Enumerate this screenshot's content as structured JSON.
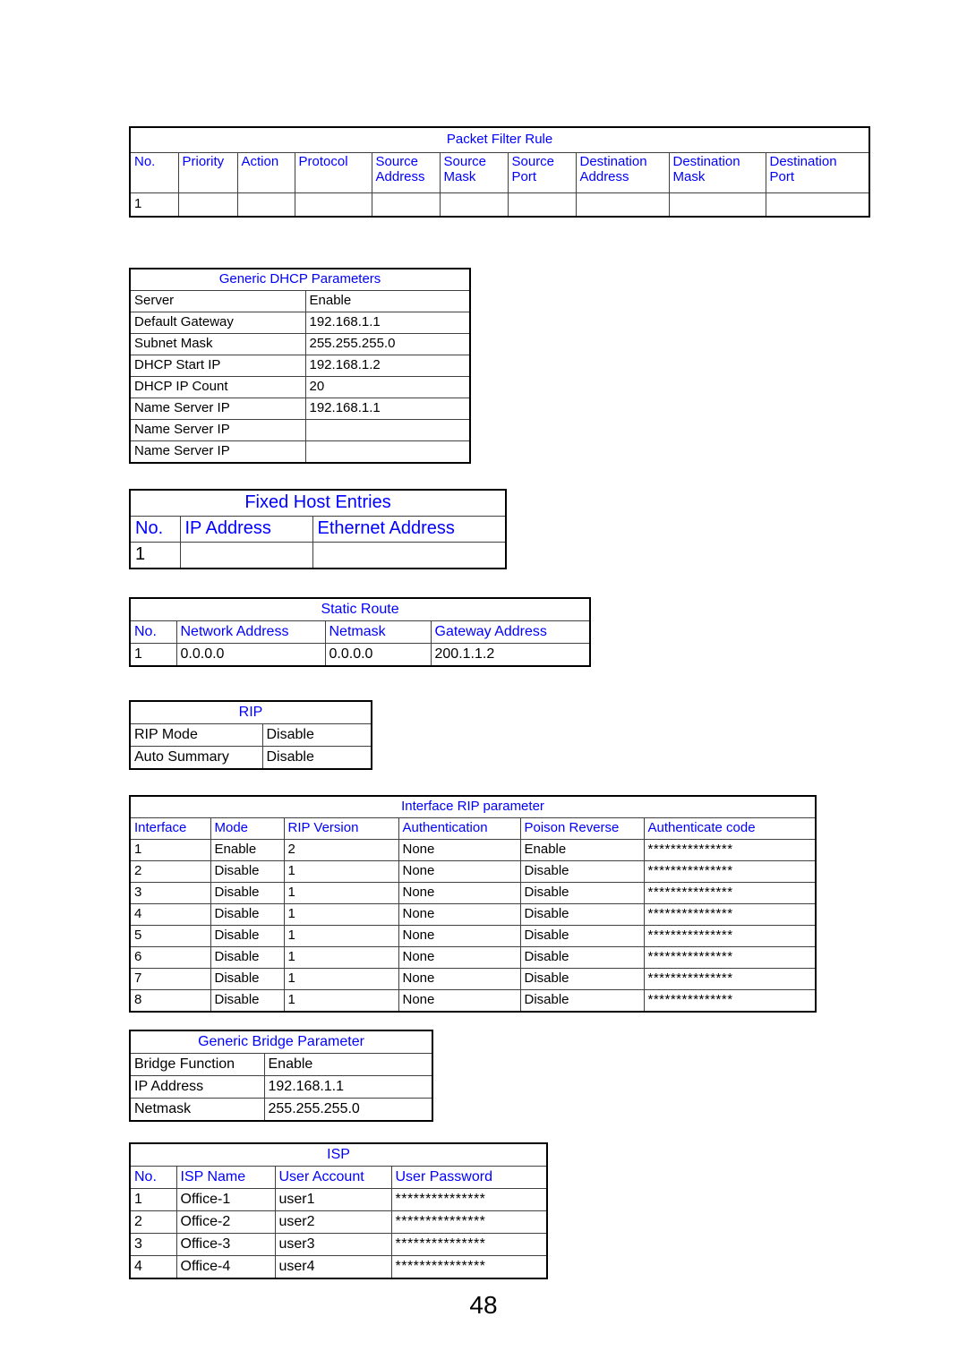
{
  "page": {
    "number": "48",
    "accent_color": "#0000FF",
    "text_color": "#000000",
    "background": "#FFFFFF"
  },
  "packet_filter_rule": {
    "title": "Packet Filter Rule",
    "headers": [
      "No.",
      "Priority",
      "Action",
      "Protocol",
      "Source Address",
      "Source Mask",
      "Source Port",
      "Destination Address",
      "Destination Mask",
      "Destination Port"
    ],
    "rows": [
      [
        "1",
        "",
        "",
        "",
        "",
        "",
        "",
        "",
        "",
        ""
      ]
    ]
  },
  "generic_dhcp_parameters": {
    "title": "Generic DHCP Parameters",
    "rows": [
      {
        "label": "Server",
        "value": "Enable"
      },
      {
        "label": "Default Gateway",
        "value": "192.168.1.1"
      },
      {
        "label": "Subnet Mask",
        "value": "255.255.255.0"
      },
      {
        "label": "DHCP Start IP",
        "value": "192.168.1.2"
      },
      {
        "label": "DHCP IP Count",
        "value": "20"
      },
      {
        "label": "Name Server IP",
        "value": "192.168.1.1"
      },
      {
        "label": "Name Server IP",
        "value": ""
      },
      {
        "label": "Name Server IP",
        "value": ""
      }
    ]
  },
  "fixed_host_entries": {
    "title": "Fixed Host Entries",
    "headers": [
      "No.",
      "IP Address",
      "Ethernet Address"
    ],
    "rows": [
      [
        "1",
        "",
        ""
      ]
    ]
  },
  "static_route": {
    "title": "Static Route",
    "headers": [
      "No.",
      "Network Address",
      "Netmask",
      "Gateway Address"
    ],
    "rows": [
      [
        "1",
        "0.0.0.0",
        "0.0.0.0",
        "200.1.1.2"
      ]
    ]
  },
  "rip": {
    "title": "RIP",
    "rows": [
      {
        "label": "RIP Mode",
        "value": "Disable"
      },
      {
        "label": "Auto Summary",
        "value": "Disable"
      }
    ]
  },
  "interface_rip_parameter": {
    "title": "Interface RIP parameter",
    "headers": [
      "Interface",
      "Mode",
      "RIP Version",
      "Authentication",
      "Poison Reverse",
      "Authenticate code"
    ],
    "rows": [
      [
        "1",
        "Enable",
        "2",
        "None",
        "Enable",
        "***************"
      ],
      [
        "2",
        "Disable",
        "1",
        "None",
        "Disable",
        "***************"
      ],
      [
        "3",
        "Disable",
        "1",
        "None",
        "Disable",
        "***************"
      ],
      [
        "4",
        "Disable",
        "1",
        "None",
        "Disable",
        "***************"
      ],
      [
        "5",
        "Disable",
        "1",
        "None",
        "Disable",
        "***************"
      ],
      [
        "6",
        "Disable",
        "1",
        "None",
        "Disable",
        "***************"
      ],
      [
        "7",
        "Disable",
        "1",
        "None",
        "Disable",
        "***************"
      ],
      [
        "8",
        "Disable",
        "1",
        "None",
        "Disable",
        "***************"
      ]
    ]
  },
  "generic_bridge_parameter": {
    "title": "Generic Bridge Parameter",
    "rows": [
      {
        "label": "Bridge Function",
        "value": "Enable"
      },
      {
        "label": "IP Address",
        "value": "192.168.1.1"
      },
      {
        "label": "Netmask",
        "value": "255.255.255.0"
      }
    ]
  },
  "isp": {
    "title": "ISP",
    "headers": [
      "No.",
      "ISP Name",
      "User Account",
      "User Password"
    ],
    "rows": [
      [
        "1",
        "Office-1",
        "user1",
        "***************"
      ],
      [
        "2",
        "Office-2",
        "user2",
        "***************"
      ],
      [
        "3",
        "Office-3",
        "user3",
        "***************"
      ],
      [
        "4",
        "Office-4",
        "user4",
        "***************"
      ]
    ]
  }
}
